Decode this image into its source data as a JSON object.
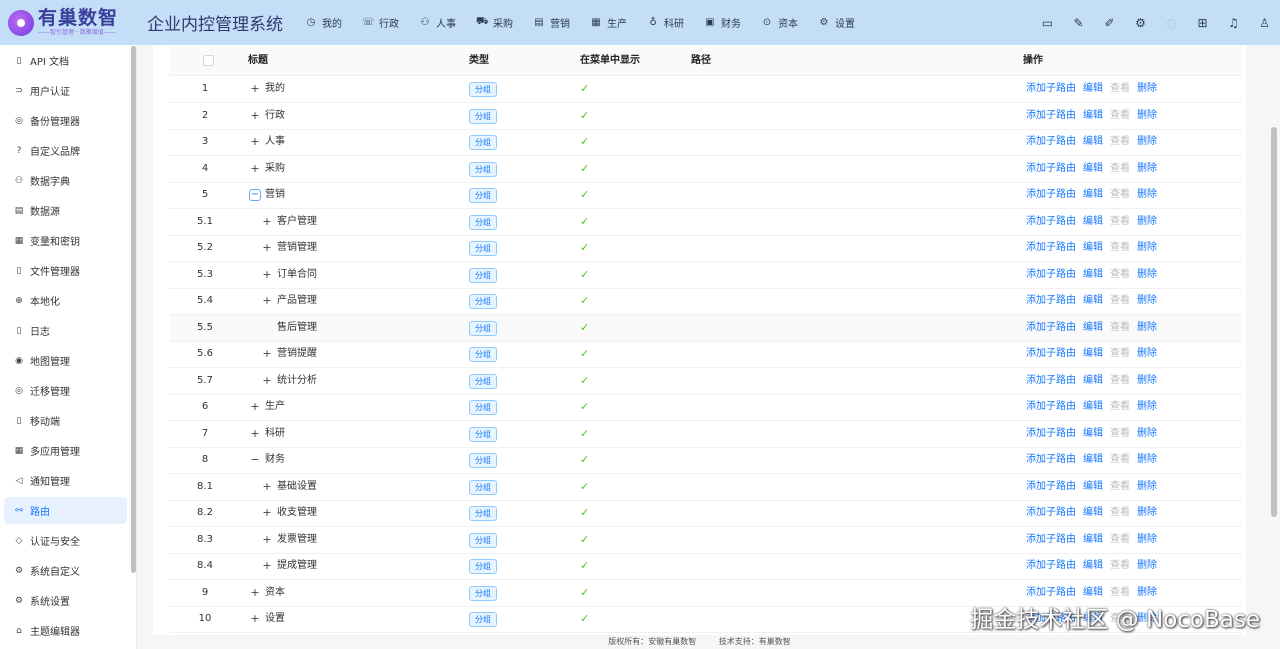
{
  "header": {
    "logo_title": "有巢数智",
    "logo_sub": "——智引管理 · 数聚增值——",
    "app_title": "企业内控管理系统",
    "nav": [
      {
        "label": "我的",
        "icon": "◷",
        "name": "my"
      },
      {
        "label": "行政",
        "icon": "☏",
        "name": "admin"
      },
      {
        "label": "人事",
        "icon": "⚇",
        "name": "hr"
      },
      {
        "label": "采购",
        "icon": "⛟",
        "name": "purchase"
      },
      {
        "label": "营销",
        "icon": "▤",
        "name": "marketing"
      },
      {
        "label": "生产",
        "icon": "▦",
        "name": "production"
      },
      {
        "label": "科研",
        "icon": "♁",
        "name": "research"
      },
      {
        "label": "财务",
        "icon": "▣",
        "name": "finance"
      },
      {
        "label": "资本",
        "icon": "⊙",
        "name": "capital"
      },
      {
        "label": "设置",
        "icon": "⚙",
        "name": "settings"
      }
    ],
    "right_icons": [
      "monitor-icon",
      "brush-icon",
      "plugin-icon",
      "gear-icon",
      "theme-icon",
      "grid-icon",
      "bell-icon",
      "user-icon"
    ]
  },
  "sidebar": {
    "items": [
      {
        "label": "API 文档",
        "icon": "▯"
      },
      {
        "label": "用户认证",
        "icon": "⊃"
      },
      {
        "label": "备份管理器",
        "icon": "◎"
      },
      {
        "label": "自定义品牌",
        "icon": "?"
      },
      {
        "label": "数据字典",
        "icon": "⚇"
      },
      {
        "label": "数据源",
        "icon": "▤"
      },
      {
        "label": "变量和密钥",
        "icon": "▦"
      },
      {
        "label": "文件管理器",
        "icon": "▯"
      },
      {
        "label": "本地化",
        "icon": "⊕"
      },
      {
        "label": "日志",
        "icon": "▯"
      },
      {
        "label": "地图管理",
        "icon": "◉"
      },
      {
        "label": "迁移管理",
        "icon": "◎"
      },
      {
        "label": "移动端",
        "icon": "▯"
      },
      {
        "label": "多应用管理",
        "icon": "▦"
      },
      {
        "label": "通知管理",
        "icon": "◁"
      },
      {
        "label": "路由",
        "icon": "⚯",
        "active": true
      },
      {
        "label": "认证与安全",
        "icon": "◇"
      },
      {
        "label": "系统自定义",
        "icon": "⚙"
      },
      {
        "label": "系统设置",
        "icon": "⚙"
      },
      {
        "label": "主题编辑器",
        "icon": "⌂"
      }
    ]
  },
  "table": {
    "columns": {
      "title": "标题",
      "type": "类型",
      "show_in_menu": "在菜单中显示",
      "path": "路径",
      "actions": "操作"
    },
    "tag_label": "分组",
    "check_mark": "✓",
    "actions": {
      "add_child": "添加子路由",
      "edit": "编辑",
      "view": "查看",
      "delete": "删除"
    },
    "rows": [
      {
        "index": "1",
        "title": "我的",
        "level": 0,
        "expander": "+"
      },
      {
        "index": "2",
        "title": "行政",
        "level": 0,
        "expander": "+"
      },
      {
        "index": "3",
        "title": "人事",
        "level": 0,
        "expander": "+"
      },
      {
        "index": "4",
        "title": "采购",
        "level": 0,
        "expander": "+"
      },
      {
        "index": "5",
        "title": "营销",
        "level": 0,
        "expander": "−",
        "boxed": true
      },
      {
        "index": "5.1",
        "title": "客户管理",
        "level": 1,
        "expander": "+"
      },
      {
        "index": "5.2",
        "title": "营销管理",
        "level": 1,
        "expander": "+"
      },
      {
        "index": "5.3",
        "title": "订单合同",
        "level": 1,
        "expander": "+"
      },
      {
        "index": "5.4",
        "title": "产品管理",
        "level": 1,
        "expander": "+"
      },
      {
        "index": "5.5",
        "title": "售后管理",
        "level": 1,
        "expander": "",
        "hover": true
      },
      {
        "index": "5.6",
        "title": "营销提醒",
        "level": 1,
        "expander": "+"
      },
      {
        "index": "5.7",
        "title": "统计分析",
        "level": 1,
        "expander": "+"
      },
      {
        "index": "6",
        "title": "生产",
        "level": 0,
        "expander": "+"
      },
      {
        "index": "7",
        "title": "科研",
        "level": 0,
        "expander": "+"
      },
      {
        "index": "8",
        "title": "财务",
        "level": 0,
        "expander": "−"
      },
      {
        "index": "8.1",
        "title": "基础设置",
        "level": 1,
        "expander": "+"
      },
      {
        "index": "8.2",
        "title": "收支管理",
        "level": 1,
        "expander": "+"
      },
      {
        "index": "8.3",
        "title": "发票管理",
        "level": 1,
        "expander": "+"
      },
      {
        "index": "8.4",
        "title": "提成管理",
        "level": 1,
        "expander": "+"
      },
      {
        "index": "9",
        "title": "资本",
        "level": 0,
        "expander": "+"
      },
      {
        "index": "10",
        "title": "设置",
        "level": 0,
        "expander": "+"
      }
    ]
  },
  "footer": {
    "copyright": "版权所有：安徽有巢数智",
    "support": "技术支持：有巢数智"
  },
  "watermark": "掘金技术社区 @ NocoBase"
}
